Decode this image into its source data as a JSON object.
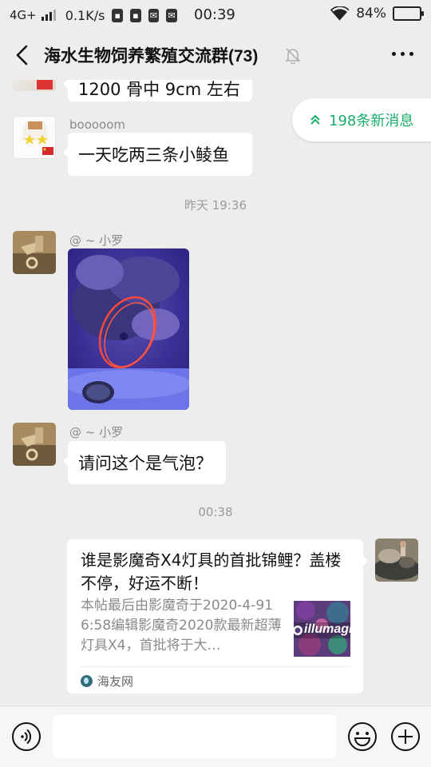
{
  "status_bar": {
    "network": "4G+",
    "speed": "0.1K/s",
    "time": "00:39",
    "battery": "84%",
    "battery_level": 0.84
  },
  "header": {
    "title": "海水生物饲养繁殖交流群(73)",
    "back_icon": "chevron-left-icon",
    "mute_icon": "bell-off-icon",
    "more_icon": "more-dots-icon"
  },
  "new_messages": {
    "label": "198条新消息"
  },
  "messages": [
    {
      "type": "text",
      "text": "1200 骨中 9cm 左右"
    },
    {
      "type": "text",
      "sender": "booooom",
      "text": "一天吃两三条小鲮鱼"
    },
    {
      "type": "time",
      "text": "昨天 19:36"
    },
    {
      "type": "image",
      "sender": "@ ~ 小罗"
    },
    {
      "type": "text",
      "sender": "@ ~ 小罗",
      "text": "请问这个是气泡？"
    },
    {
      "type": "time",
      "text": "00:38"
    },
    {
      "type": "link_card",
      "title": "谁是影魔奇X4灯具的首批锦鲤？盖楼不停，好运不断！",
      "description": "本帖最后由影魔奇于2020-4-916:58编辑影魔奇2020款最新超薄灯具X4，首批将于大…",
      "thumbnail_text": "illumagi",
      "source": "海友网"
    }
  ],
  "input_bar": {
    "placeholder": "",
    "voice_icon": "voice-icon",
    "emoji_icon": "emoji-icon",
    "plus_icon": "plus-icon"
  },
  "colors": {
    "background": "#ededed",
    "bubble": "#ffffff",
    "accent_green": "#1aad6b",
    "secondary_text": "#8a8a8a"
  }
}
